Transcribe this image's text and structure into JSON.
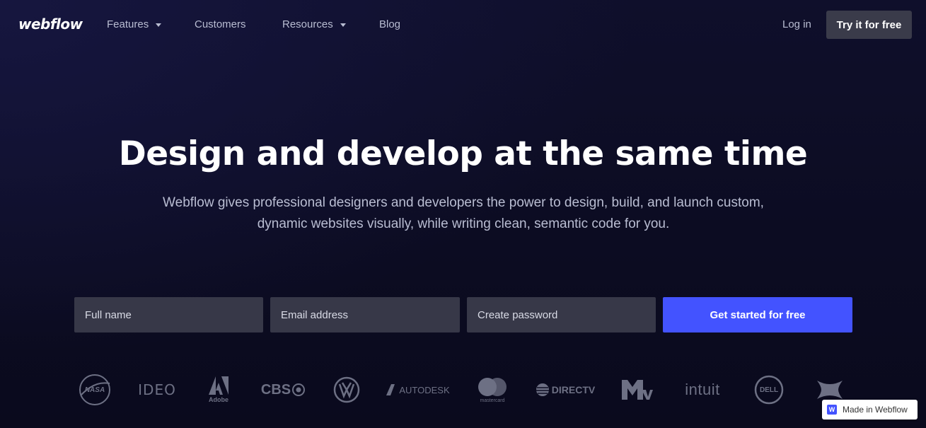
{
  "nav": {
    "logo": "webflow",
    "items": [
      {
        "label": "Features",
        "dropdown": true
      },
      {
        "label": "Customers",
        "dropdown": false
      },
      {
        "label": "Resources",
        "dropdown": true
      },
      {
        "label": "Blog",
        "dropdown": false
      }
    ],
    "login": "Log in",
    "try_button": "Try it for free"
  },
  "hero": {
    "title": "Design and develop at the same time",
    "subtitle": "Webflow gives professional designers and developers the power to design, build, and launch custom, dynamic websites visually, while writing clean, semantic code for you."
  },
  "signup": {
    "full_name_placeholder": "Full name",
    "email_placeholder": "Email address",
    "password_placeholder": "Create password",
    "submit_label": "Get started for free"
  },
  "customer_logos": [
    {
      "name": "NASA",
      "label": "NASA"
    },
    {
      "name": "IDEO",
      "label": "IDEO"
    },
    {
      "name": "Adobe",
      "label": "Adobe"
    },
    {
      "name": "CBS",
      "label": "CBS"
    },
    {
      "name": "Volkswagen",
      "label": ""
    },
    {
      "name": "Autodesk",
      "label": "AUTODESK"
    },
    {
      "name": "Mastercard",
      "label": "mastercard"
    },
    {
      "name": "DirecTV",
      "label": "DIRECTV"
    },
    {
      "name": "MTV",
      "label": ""
    },
    {
      "name": "Intuit",
      "label": "intuit"
    },
    {
      "name": "Dell",
      "label": "DELL"
    },
    {
      "name": "Under Armour",
      "label": ""
    }
  ],
  "badge": {
    "icon_letter": "W",
    "label": "Made in Webflow"
  },
  "colors": {
    "background": "#0f0f2b",
    "field_bg": "#373848",
    "cta_blue": "#4353ff",
    "nav_text": "#b9bdd2",
    "logo_gray": "#6d7084"
  }
}
